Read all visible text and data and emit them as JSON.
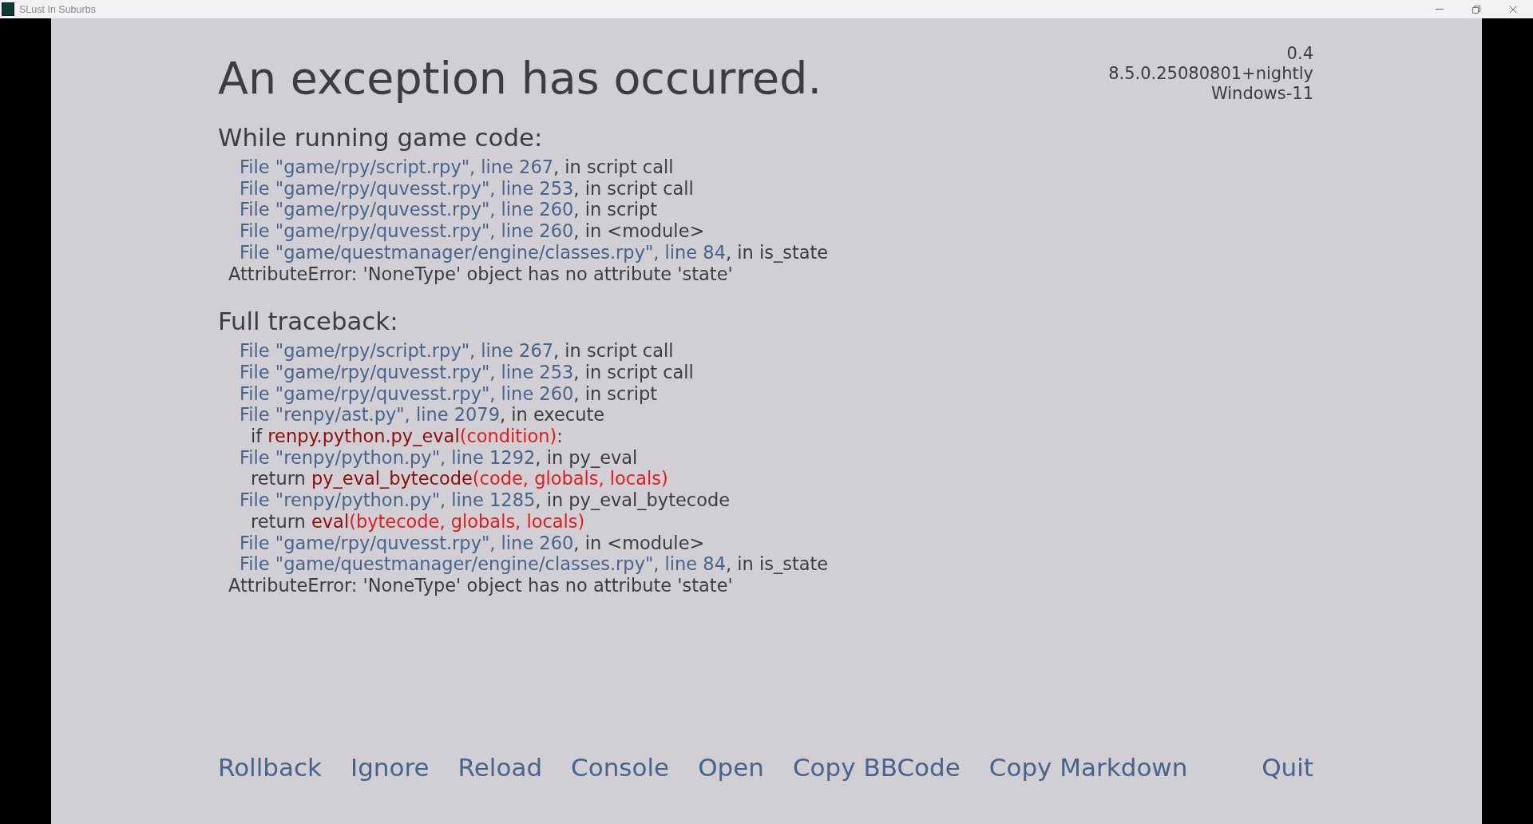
{
  "window": {
    "title": "SLust In Suburbs"
  },
  "report": {
    "title": "An exception has occurred.",
    "version_lines": [
      "0.4",
      "8.5.0.25080801+nightly",
      "Windows-11"
    ],
    "sections": [
      {
        "heading": "While running game code:",
        "lines": [
          {
            "kind": "frame",
            "location": "File \"game/rpy/script.rpy\", line 267",
            "context": ", in script call"
          },
          {
            "kind": "frame",
            "location": "File \"game/rpy/quvesst.rpy\", line 253",
            "context": ", in script call"
          },
          {
            "kind": "frame",
            "location": "File \"game/rpy/quvesst.rpy\", line 260",
            "context": ", in script"
          },
          {
            "kind": "frame",
            "location": "File \"game/rpy/quvesst.rpy\", line 260",
            "context": ", in <module>"
          },
          {
            "kind": "frame",
            "location": "File \"game/questmanager/engine/classes.rpy\", line 84",
            "context": ", in is_state"
          },
          {
            "kind": "error",
            "text": "AttributeError: 'NoneType' object has no attribute 'state'"
          }
        ]
      },
      {
        "heading": "Full traceback:",
        "lines": [
          {
            "kind": "frame",
            "location": "File \"game/rpy/script.rpy\", line 267",
            "context": ", in script call"
          },
          {
            "kind": "frame",
            "location": "File \"game/rpy/quvesst.rpy\", line 253",
            "context": ", in script call"
          },
          {
            "kind": "frame",
            "location": "File \"game/rpy/quvesst.rpy\", line 260",
            "context": ", in script"
          },
          {
            "kind": "frame",
            "location": "File \"renpy/ast.py\", line 2079",
            "context": ", in execute"
          },
          {
            "kind": "source",
            "lead": "if ",
            "call": "renpy.python.py_eval",
            "args": "(condition)",
            "tail": ":"
          },
          {
            "kind": "frame",
            "location": "File \"renpy/python.py\", line 1292",
            "context": ", in py_eval"
          },
          {
            "kind": "source",
            "lead": "return ",
            "call": "py_eval_bytecode",
            "args": "(code, globals, locals)"
          },
          {
            "kind": "frame",
            "location": "File \"renpy/python.py\", line 1285",
            "context": ", in py_eval_bytecode"
          },
          {
            "kind": "source",
            "lead": "return ",
            "call": "eval",
            "args": "(bytecode, globals, locals)"
          },
          {
            "kind": "frame",
            "location": "File \"game/rpy/quvesst.rpy\", line 260",
            "context": ", in <module>"
          },
          {
            "kind": "frame",
            "location": "File \"game/questmanager/engine/classes.rpy\", line 84",
            "context": ", in is_state"
          },
          {
            "kind": "error",
            "text": "AttributeError: 'NoneType' object has no attribute 'state'"
          }
        ]
      }
    ]
  },
  "actions": [
    {
      "label": "Rollback"
    },
    {
      "label": "Ignore"
    },
    {
      "label": "Reload"
    },
    {
      "label": "Console"
    },
    {
      "label": "Open"
    },
    {
      "label": "Copy BBCode"
    },
    {
      "label": "Copy Markdown"
    }
  ],
  "quit": {
    "label": "Quit"
  }
}
